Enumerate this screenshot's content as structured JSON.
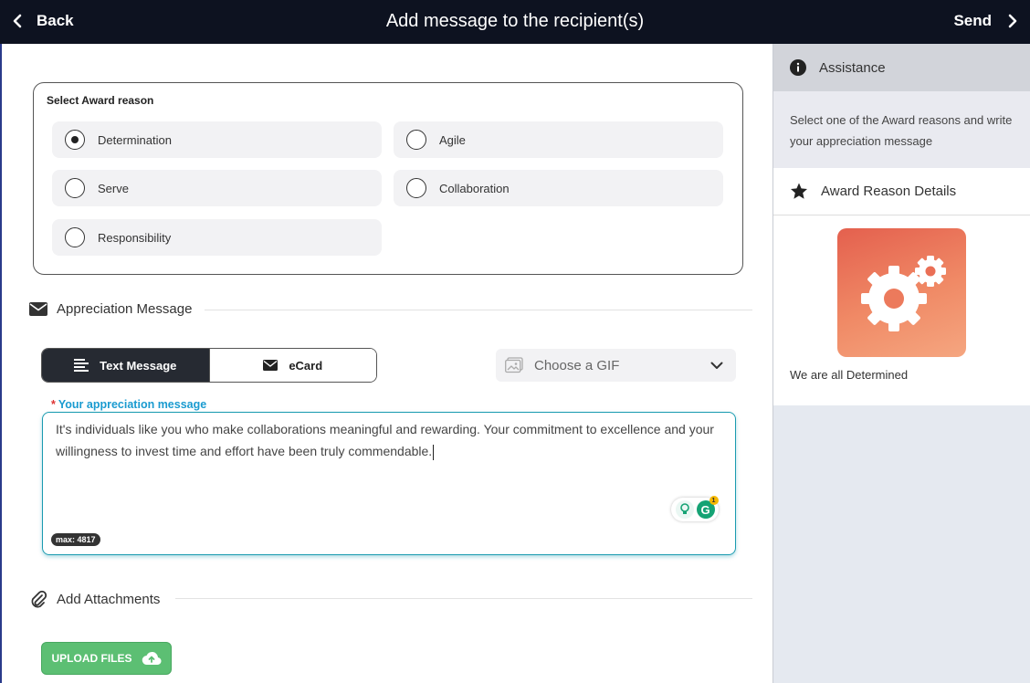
{
  "header": {
    "back_label": "Back",
    "title": "Add message to the recipient(s)",
    "send_label": "Send"
  },
  "award_reason": {
    "legend": "Select Award reason",
    "selected": "Determination",
    "options": [
      {
        "label": "Determination",
        "selected": true
      },
      {
        "label": "Agile",
        "selected": false
      },
      {
        "label": "Serve",
        "selected": false
      },
      {
        "label": "Collaboration",
        "selected": false
      },
      {
        "label": "Responsibility",
        "selected": false
      }
    ]
  },
  "appreciation": {
    "section_title": "Appreciation Message",
    "tabs": [
      {
        "label": "Text Message",
        "active": true,
        "icon": "text-lines-icon"
      },
      {
        "label": "eCard",
        "active": false,
        "icon": "envelope-icon"
      }
    ],
    "gif_placeholder": "Choose a GIF",
    "message_label": "Your appreciation message",
    "required_marker": "*",
    "message_text": "It's individuals like you who make collaborations meaningful and rewarding. Your commitment to excellence and your willingness to invest time and effort have been truly commendable.",
    "max_badge": "max: 4817",
    "grammarly_count": "1"
  },
  "attachments": {
    "section_title": "Add Attachments",
    "upload_label": "UPLOAD FILES"
  },
  "sidebar": {
    "assistance_title": "Assistance",
    "assistance_text": "Select one of the Award reasons and write your appreciation message",
    "details_title": "Award Reason Details",
    "award_caption": "We are all Determined",
    "award_icon": "gears-icon"
  },
  "colors": {
    "topbar": "#0d1220",
    "accent": "#1a9bd0",
    "upload_green": "#5cbf73",
    "award_gradient_start": "#e4604e",
    "award_gradient_end": "#f5a680"
  }
}
